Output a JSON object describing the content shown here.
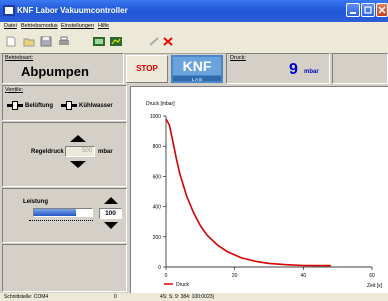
{
  "window": {
    "title": "KNF Labor Vakuumcontroller"
  },
  "menu": [
    "Datei",
    "Betriebsmodus",
    "Einstellungen",
    "Hilfe"
  ],
  "toolbar": {
    "icons": [
      "new-icon",
      "open-icon",
      "save-icon",
      "print-icon",
      "controller-icon",
      "chart-icon",
      "link-icon",
      "cut-icon"
    ]
  },
  "mode": {
    "label": "Betriebsart:",
    "value": "Abpumpen"
  },
  "stop_label": "STOP",
  "logo": {
    "top": "KNF",
    "bottom": "L A B"
  },
  "pressure": {
    "label": "Druck:",
    "value": "9",
    "unit": "mbar"
  },
  "valves": {
    "label": "Ventile:",
    "items": [
      "Belüftung",
      "Kühlwasser"
    ]
  },
  "control_pressure": {
    "label": "Regeldruck",
    "value": "500",
    "unit": "mbar"
  },
  "power": {
    "label": "Leistung",
    "value": "100",
    "level": 0.72
  },
  "status": {
    "interface": "Schnittstelle: COM4",
    "zero": "0",
    "info": "4S: S: 9: 384: 100:0023)"
  },
  "colors": {
    "titlebar": "#245edb",
    "curve": "#d40000",
    "pressure_value": "#0000d0"
  },
  "chart_data": {
    "type": "line",
    "title": "",
    "ylabel": "Druck [mbar]",
    "xlabel": "Zeit [s]",
    "xlim": [
      0,
      60
    ],
    "ylim": [
      0,
      1000
    ],
    "xticks": [
      0,
      20,
      40,
      60
    ],
    "yticks": [
      0,
      200,
      400,
      600,
      800,
      1000
    ],
    "legend": "bottom-left",
    "grid": false,
    "series": [
      {
        "name": "Druck",
        "x": [
          0,
          1,
          2,
          3,
          4,
          6,
          8,
          10,
          12,
          15,
          18,
          22,
          26,
          30,
          35,
          40,
          45,
          48
        ],
        "values": [
          980,
          940,
          830,
          720,
          620,
          470,
          360,
          275,
          210,
          145,
          100,
          60,
          38,
          24,
          15,
          10,
          9,
          9
        ]
      }
    ]
  }
}
